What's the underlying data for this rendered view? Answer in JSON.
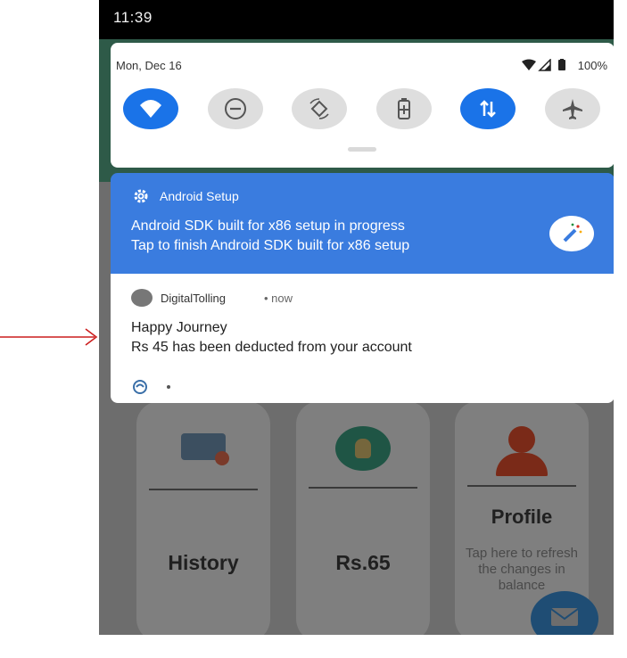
{
  "statusbar": {
    "time": "11:39"
  },
  "quick_settings": {
    "date": "Mon, Dec 16",
    "battery": "100%",
    "tiles": [
      {
        "icon": "wifi-icon",
        "active": true
      },
      {
        "icon": "do-not-disturb-icon",
        "active": false
      },
      {
        "icon": "auto-rotate-icon",
        "active": false
      },
      {
        "icon": "battery-saver-icon",
        "active": false
      },
      {
        "icon": "mobile-data-icon",
        "active": true
      },
      {
        "icon": "airplane-mode-icon",
        "active": false
      }
    ]
  },
  "notifications": [
    {
      "app": "Android Setup",
      "lines": [
        "Android SDK built for x86 setup in progress",
        "Tap to finish Android SDK built for x86 setup"
      ],
      "icon": "gear-icon",
      "badge_icon": "magic-wand-icon",
      "color": "#3a7cdf"
    },
    {
      "app": "DigitalTolling",
      "time": "• now",
      "title": "Happy Journey",
      "text": "Rs 45 has been deducted from your account",
      "footer_icon": "nfc-icon",
      "footer_dot": "•"
    }
  ],
  "app_cards": [
    {
      "title": "History",
      "icon": "history-card-icon"
    },
    {
      "title": "Rs.65",
      "icon": "money-bag-icon"
    },
    {
      "title": "Profile",
      "desc": "Tap here to refresh the changes in balance",
      "icon": "profile-icon"
    }
  ],
  "fab": {
    "icon": "mail-icon"
  },
  "annotation": {
    "color": "#cc1f1f"
  }
}
